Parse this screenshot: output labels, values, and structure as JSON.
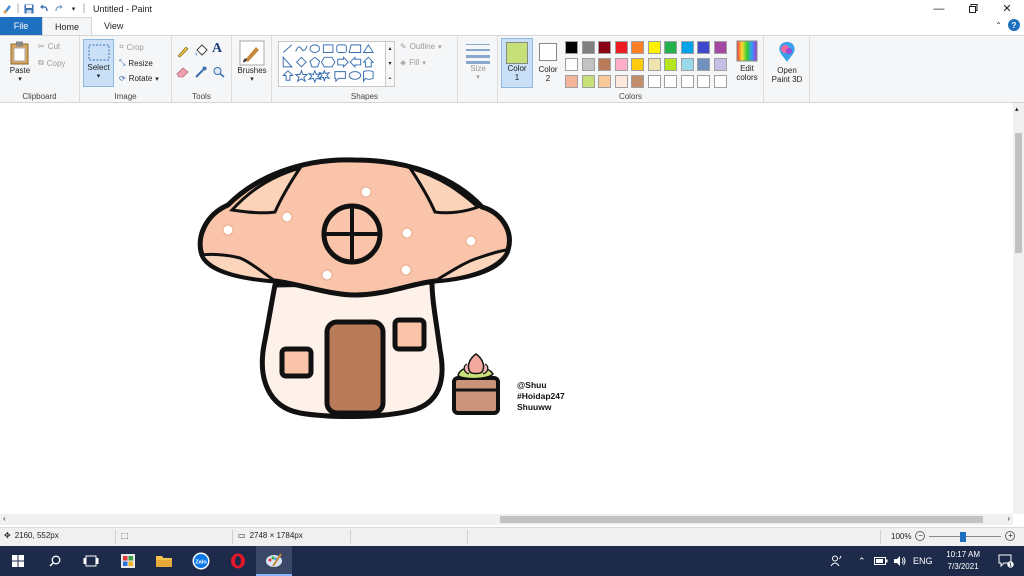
{
  "window": {
    "title": "Untitled - Paint"
  },
  "tabs": {
    "file": "File",
    "home": "Home",
    "view": "View"
  },
  "clipboard": {
    "paste": "Paste",
    "cut": "Cut",
    "copy": "Copy",
    "label": "Clipboard"
  },
  "image": {
    "select": "Select",
    "crop": "Crop",
    "resize": "Resize",
    "rotate": "Rotate",
    "label": "Image"
  },
  "tools": {
    "label": "Tools"
  },
  "brushes": {
    "label": "Brushes"
  },
  "shapes": {
    "outline": "Outline",
    "fill": "Fill",
    "label": "Shapes"
  },
  "size": {
    "label": "Size"
  },
  "colors": {
    "color1": "Color 1",
    "color2": "Color 2",
    "color1_value": "#c8e07a",
    "color2_value": "#ffffff",
    "edit": "Edit colors",
    "label": "Colors",
    "palette": [
      [
        "#000000",
        "#7f7f7f",
        "#880015",
        "#ed1c24",
        "#ff7f27",
        "#fff200",
        "#22b14c",
        "#00a2e8",
        "#3f48cc",
        "#a349a4"
      ],
      [
        "#ffffff",
        "#c3c3c3",
        "#b97a57",
        "#ffaec9",
        "#ffc90e",
        "#efe4b0",
        "#b5e61d",
        "#99d9ea",
        "#7092be",
        "#c8bfe7"
      ],
      [
        "#f4b49a",
        "#c8e07a",
        "#f9c99a",
        "#fde8dc",
        "#c18d6d",
        "#ffffff",
        "#ffffff",
        "#ffffff",
        "#ffffff",
        "#ffffff"
      ]
    ]
  },
  "paint3d": {
    "label": "Open Paint 3D"
  },
  "canvas_text": {
    "line1": "@Shuu",
    "line2": "#Hoidap247",
    "line3": "Shuuww"
  },
  "status": {
    "cursor": "2160, 552px",
    "size": "2748 × 1784px",
    "zoom": "100%"
  },
  "taskbar": {
    "lang": "ENG",
    "time": "10:17 AM",
    "date": "7/3/2021"
  }
}
